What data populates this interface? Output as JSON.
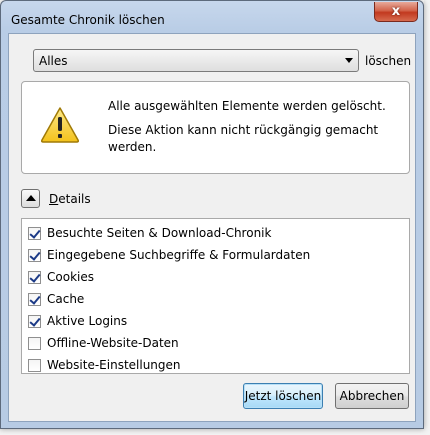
{
  "window": {
    "title": "Gesamte Chronik löschen",
    "close_glyph": "x"
  },
  "time_range": {
    "selected": "Alles",
    "suffix": "löschen"
  },
  "warning": {
    "icon": "warning-icon",
    "line1": "Alle ausgewählten Elemente werden gelöscht.",
    "line2": "Diese Aktion kann nicht rückgängig gemacht werden."
  },
  "details": {
    "label_underlined": "D",
    "label_rest": "etails",
    "expanded": true
  },
  "items": [
    {
      "label": "Besuchte Seiten & Download-Chronik",
      "checked": true
    },
    {
      "label": "Eingegebene Suchbegriffe & Formulardaten",
      "checked": true
    },
    {
      "label": "Cookies",
      "checked": true
    },
    {
      "label": "Cache",
      "checked": true
    },
    {
      "label": "Aktive Logins",
      "checked": true
    },
    {
      "label": "Offline-Website-Daten",
      "checked": false
    },
    {
      "label": "Website-Einstellungen",
      "checked": false
    }
  ],
  "buttons": {
    "confirm": "Jetzt löschen",
    "cancel": "Abbrechen"
  },
  "colors": {
    "frame": "#b9cde6",
    "close": "#c2391f",
    "check": "#1c3a87",
    "primary_button": "#bee6fd"
  }
}
